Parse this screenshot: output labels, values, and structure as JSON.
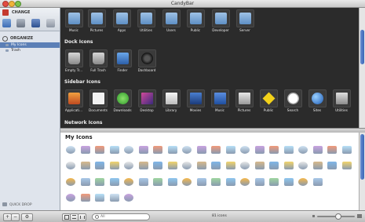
{
  "window": {
    "title": "CandyBar"
  },
  "sidebar": {
    "change_label": "CHANGE",
    "organize_label": "ORGANIZE",
    "items": [
      {
        "label": "My Icons",
        "selected": true
      },
      {
        "label": "Trash",
        "selected": false
      }
    ],
    "quick_drop_label": "QUICK DROP"
  },
  "top_row_icons": [
    "Music",
    "Pictures",
    "Apps",
    "Utilities",
    "Users",
    "Public",
    "Developer",
    "Server"
  ],
  "sections": [
    {
      "title": "Dock Icons",
      "icons": [
        "Empty Tr...",
        "Full Trash",
        "Finder",
        "Dashboard"
      ]
    },
    {
      "title": "Sidebar Icons",
      "icons": [
        "Applicati...",
        "Documents",
        "Downloads",
        "Desktop",
        "Library",
        "Movies",
        "Music",
        "Pictures",
        "Public",
        "Search",
        "Sites",
        "Utilities"
      ]
    },
    {
      "title": "Network Icons",
      "icons": []
    }
  ],
  "my_icons": {
    "title": "My Icons"
  },
  "bottom": {
    "search_placeholder": "All",
    "count": "81 icons",
    "add_label": "+",
    "remove_label": "−",
    "gear_label": "⚙"
  },
  "colors": {
    "accent": "#5b7fb6",
    "dark_pane": "#2b2b2b"
  }
}
